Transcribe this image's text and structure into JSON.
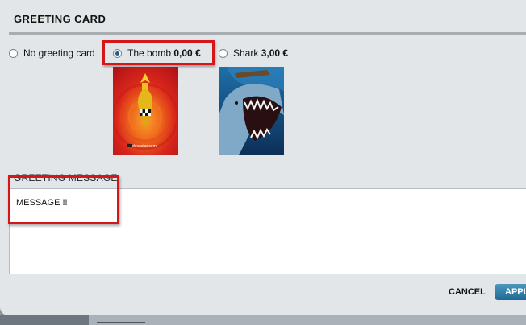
{
  "dialog": {
    "title": "GREETING CARD",
    "options": [
      {
        "label": "No greeting card",
        "price": "",
        "selected": false
      },
      {
        "label": "The bomb",
        "price": "0,00 €",
        "selected": true
      },
      {
        "label": "Shark",
        "price": "3,00 €",
        "selected": false
      }
    ],
    "thumbnails": {
      "bomb_caption": "desastar.com"
    },
    "message_section": {
      "label": "GREETING MESSAGE",
      "value": "MESSAGE !!"
    },
    "buttons": {
      "cancel": "CANCEL",
      "apply": "APPLY"
    }
  },
  "colors": {
    "highlight": "#d4181a",
    "apply_button": "#2a78a5",
    "dialog_bg": "#e3e6e8"
  }
}
